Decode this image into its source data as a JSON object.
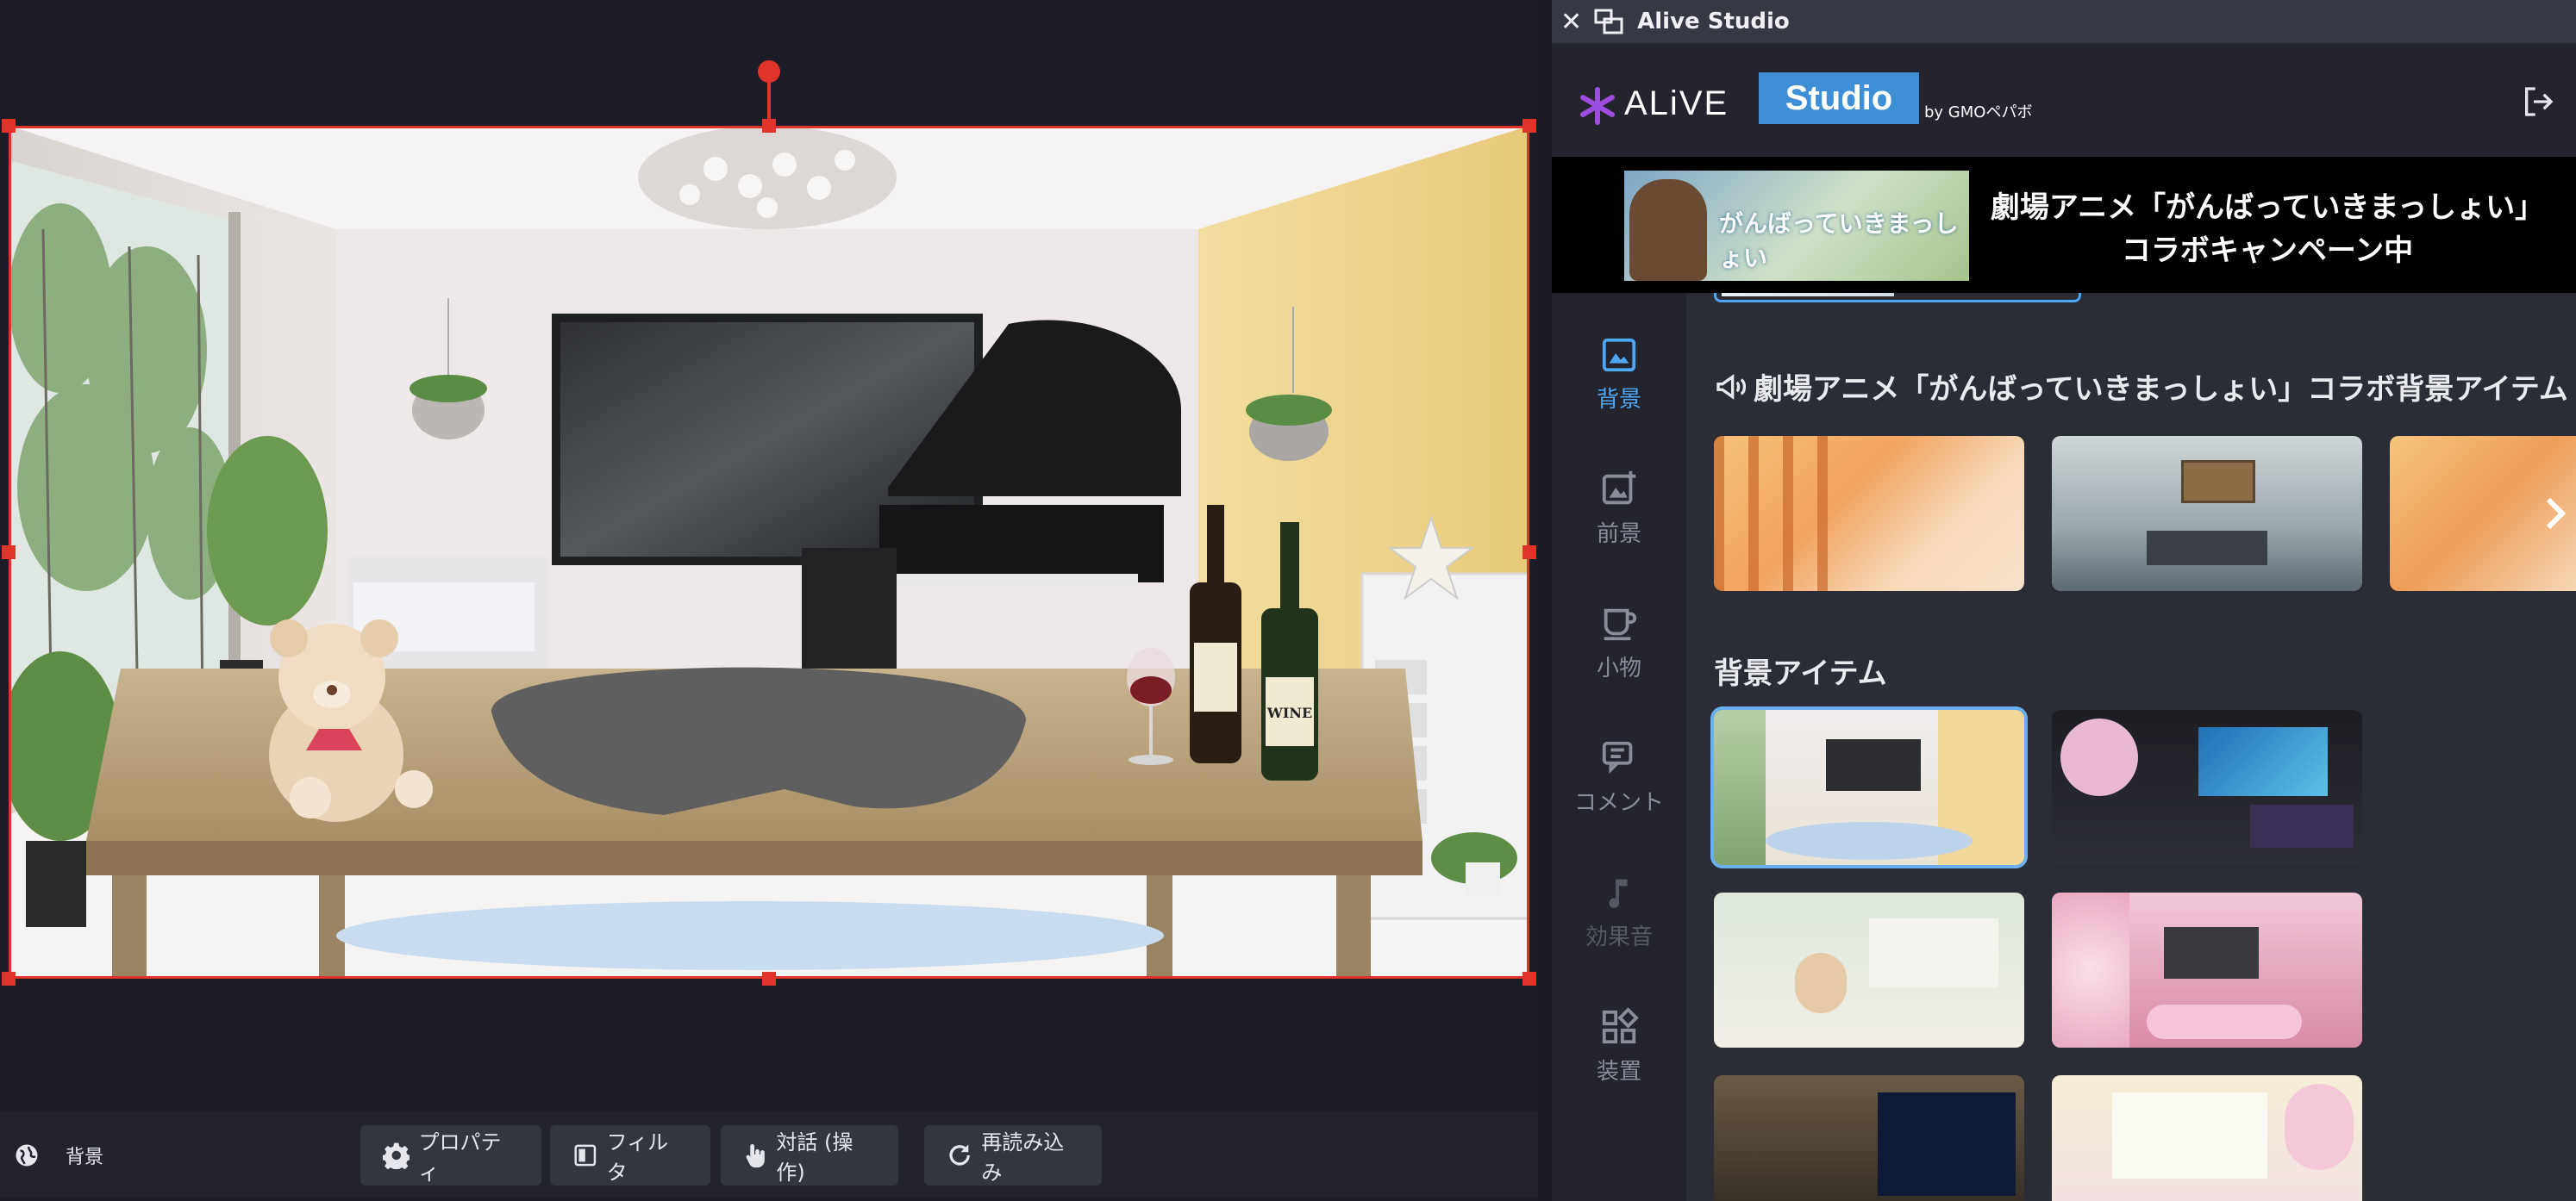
{
  "window": {
    "title": "Alive Studio"
  },
  "brand": {
    "logo_text": "ALiVE",
    "badge": "Studio",
    "by": "by GMOペパボ"
  },
  "banner": {
    "image_caption": "がんばっていきまっしょい",
    "line1": "劇場アニメ「がんばっていきまっしょい」",
    "line2": "コラボキャンペーン中"
  },
  "sidebar": {
    "items": [
      {
        "label": "背景",
        "icon": "image-icon"
      },
      {
        "label": "前景",
        "icon": "image-add-icon"
      },
      {
        "label": "小物",
        "icon": "cup-icon"
      },
      {
        "label": "コメント",
        "icon": "comment-icon"
      },
      {
        "label": "効果音",
        "icon": "music-note-icon"
      },
      {
        "label": "装置",
        "icon": "widgets-icon"
      }
    ]
  },
  "sections": {
    "collab_title": "劇場アニメ「がんばっていきまっしょい」コラボ背景アイテム",
    "items_title": "背景アイテム"
  },
  "toolbar": {
    "layer": "背景",
    "properties": "プロパティ",
    "filter": "フィルタ",
    "dialog": "対話 (操作)",
    "reload": "再読み込み"
  },
  "scene": {
    "bottle_label": "WINE"
  },
  "colors": {
    "accent": "#4ea6f5",
    "selection": "#e0342b",
    "studio_badge": "#3f8fd6"
  }
}
